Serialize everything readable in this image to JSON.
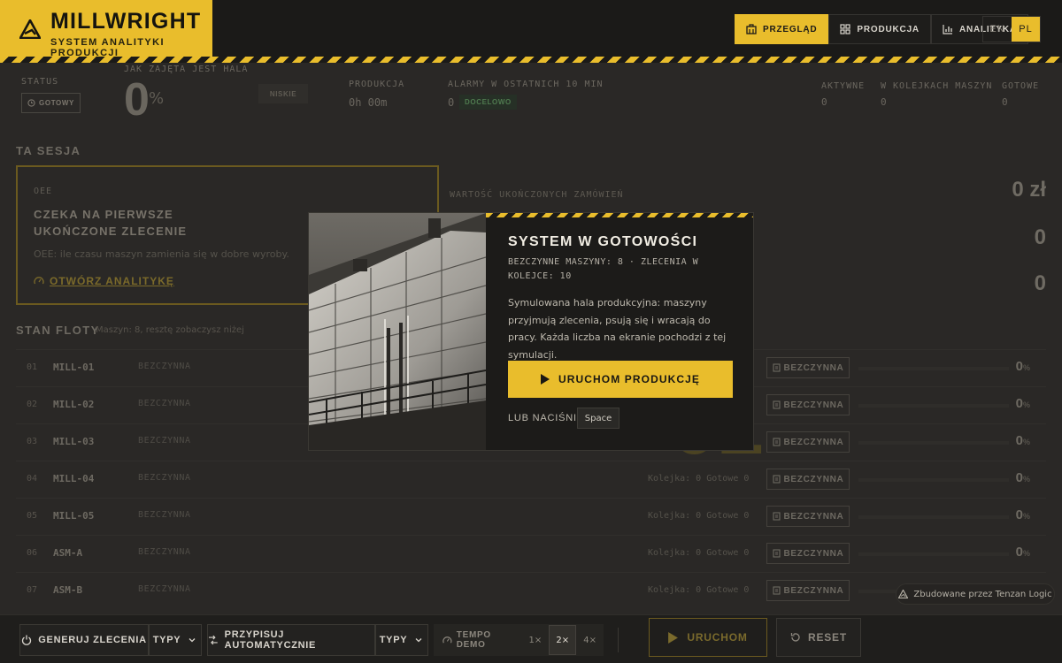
{
  "brand": {
    "name": "MILLWRIGHT",
    "subtitle": "SYSTEM ANALITYKI PRODUKCJI"
  },
  "nav": [
    {
      "label": "PRZEGLĄD",
      "icon": "building-icon",
      "active": true
    },
    {
      "label": "PRODUKCJA",
      "icon": "grid-icon",
      "active": false
    },
    {
      "label": "ANALITYKA",
      "icon": "chart-icon",
      "active": false
    }
  ],
  "lang": {
    "en": "EN",
    "pl": "PL",
    "active": "PL"
  },
  "status": {
    "label": "STATUS",
    "badge": "GOTOWY",
    "hall_label": "JAK ZAJĘTA JEST HALA",
    "hall_value": "0",
    "hall_unit": "%",
    "low_badge": "NISKIE",
    "production_label": "PRODUKCJA",
    "production_value": "0h 00m",
    "alarms_label": "ALARMY W OSTATNICH 10 MIN",
    "alarms_value": "0",
    "alarms_badge": "DOCELOWO",
    "active_label": "AKTYWNE",
    "active_value": "0",
    "queued_label": "W KOLEJKACH MASZYN",
    "queued_value": "0",
    "done_label": "GOTOWE",
    "done_value": "0"
  },
  "session": {
    "title": "TA SESJA",
    "oee_label": "OEE",
    "oee_heading": "CZEKA NA PIERWSZE UKOŃCZONE ZLECENIE",
    "oee_desc": "OEE: ile czasu maszyn zamienia się w dobre wyroby.",
    "oee_link": "OTWÓRZ ANALITYKĘ",
    "kpi_label": "WARTOŚĆ UKOŃCZONYCH ZAMÓWIEŃ",
    "kpi_value": "0 zł",
    "kpi2_value": "0",
    "kpi3_value": "0"
  },
  "fleet": {
    "title": "STAN FLOTY",
    "note": "Maszyn: 8, resztę zobaczysz niżej",
    "big_number": "01",
    "rows": [
      {
        "idx": "01",
        "name": "MILL-01",
        "state": "BEZCZYNNA",
        "meta": "",
        "badge": "BEZCZYNNA",
        "pct": "0",
        "unit": "%"
      },
      {
        "idx": "02",
        "name": "MILL-02",
        "state": "BEZCZYNNA",
        "meta": "",
        "badge": "BEZCZYNNA",
        "pct": "0",
        "unit": "%"
      },
      {
        "idx": "03",
        "name": "MILL-03",
        "state": "BEZCZYNNA",
        "meta": "",
        "badge": "BEZCZYNNA",
        "pct": "0",
        "unit": "%"
      },
      {
        "idx": "04",
        "name": "MILL-04",
        "state": "BEZCZYNNA",
        "meta": "Kolejka: 0  Gotowe 0",
        "badge": "BEZCZYNNA",
        "pct": "0",
        "unit": "%"
      },
      {
        "idx": "05",
        "name": "MILL-05",
        "state": "BEZCZYNNA",
        "meta": "Kolejka: 0  Gotowe 0",
        "badge": "BEZCZYNNA",
        "pct": "0",
        "unit": "%"
      },
      {
        "idx": "06",
        "name": "ASM-A",
        "state": "BEZCZYNNA",
        "meta": "Kolejka: 0  Gotowe 0",
        "badge": "BEZCZYNNA",
        "pct": "0",
        "unit": "%"
      },
      {
        "idx": "07",
        "name": "ASM-B",
        "state": "BEZCZYNNA",
        "meta": "Kolejka: 0  Gotowe 0",
        "badge": "BEZCZYNNA",
        "pct": "",
        "unit": ""
      }
    ]
  },
  "modal": {
    "title": "SYSTEM W GOTOWOŚCI",
    "subtitle": "BEZCZYNNE MASZYNY: 8 · ZLECENIA W KOLEJCE: 10",
    "description": "Symulowana hala produkcyjna: maszyny przyjmują zlecenia, psują się i wracają do pracy. Każda liczba na ekranie pochodzi z tej symulacji.",
    "run_label": "URUCHOM PRODUKCJĘ",
    "or_press": "LUB NACIŚNIJ",
    "key": "Space"
  },
  "bottombar": {
    "generate": "GENERUJ ZLECENIA",
    "types1": "TYPY",
    "auto_assign": "PRZYPISUJ AUTOMATYCZNIE",
    "types2": "TYPY",
    "tempo": "TEMPO DEMO",
    "speeds": [
      "1×",
      "2×",
      "4×"
    ],
    "active_speed": "2×",
    "run": "URUCHOM",
    "reset": "RESET"
  },
  "credit": "Zbudowane przez Tenzan Logic",
  "colors": {
    "accent": "#e9bd2c",
    "background": "#2a2826",
    "panel": "#1c1b19"
  }
}
